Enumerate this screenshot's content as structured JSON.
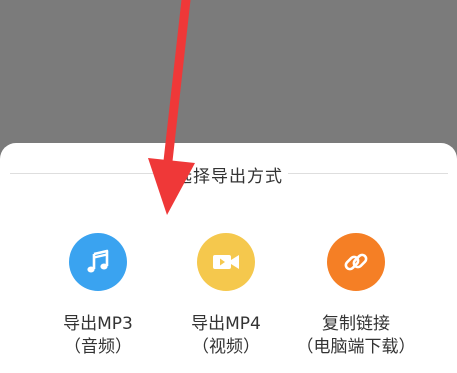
{
  "sheet": {
    "title": "选择导出方式",
    "options": [
      {
        "label": "导出MP3",
        "sublabel": "（音频）",
        "icon": "music-note-icon",
        "color": "#3aa3f0"
      },
      {
        "label": "导出MP4",
        "sublabel": "（视频）",
        "icon": "video-camera-icon",
        "color": "#f5c84d"
      },
      {
        "label": "复制链接",
        "sublabel": "（电脑端下载）",
        "icon": "link-icon",
        "color": "#f57f25"
      }
    ]
  },
  "annotation": {
    "arrow_color": "#ef3838"
  }
}
